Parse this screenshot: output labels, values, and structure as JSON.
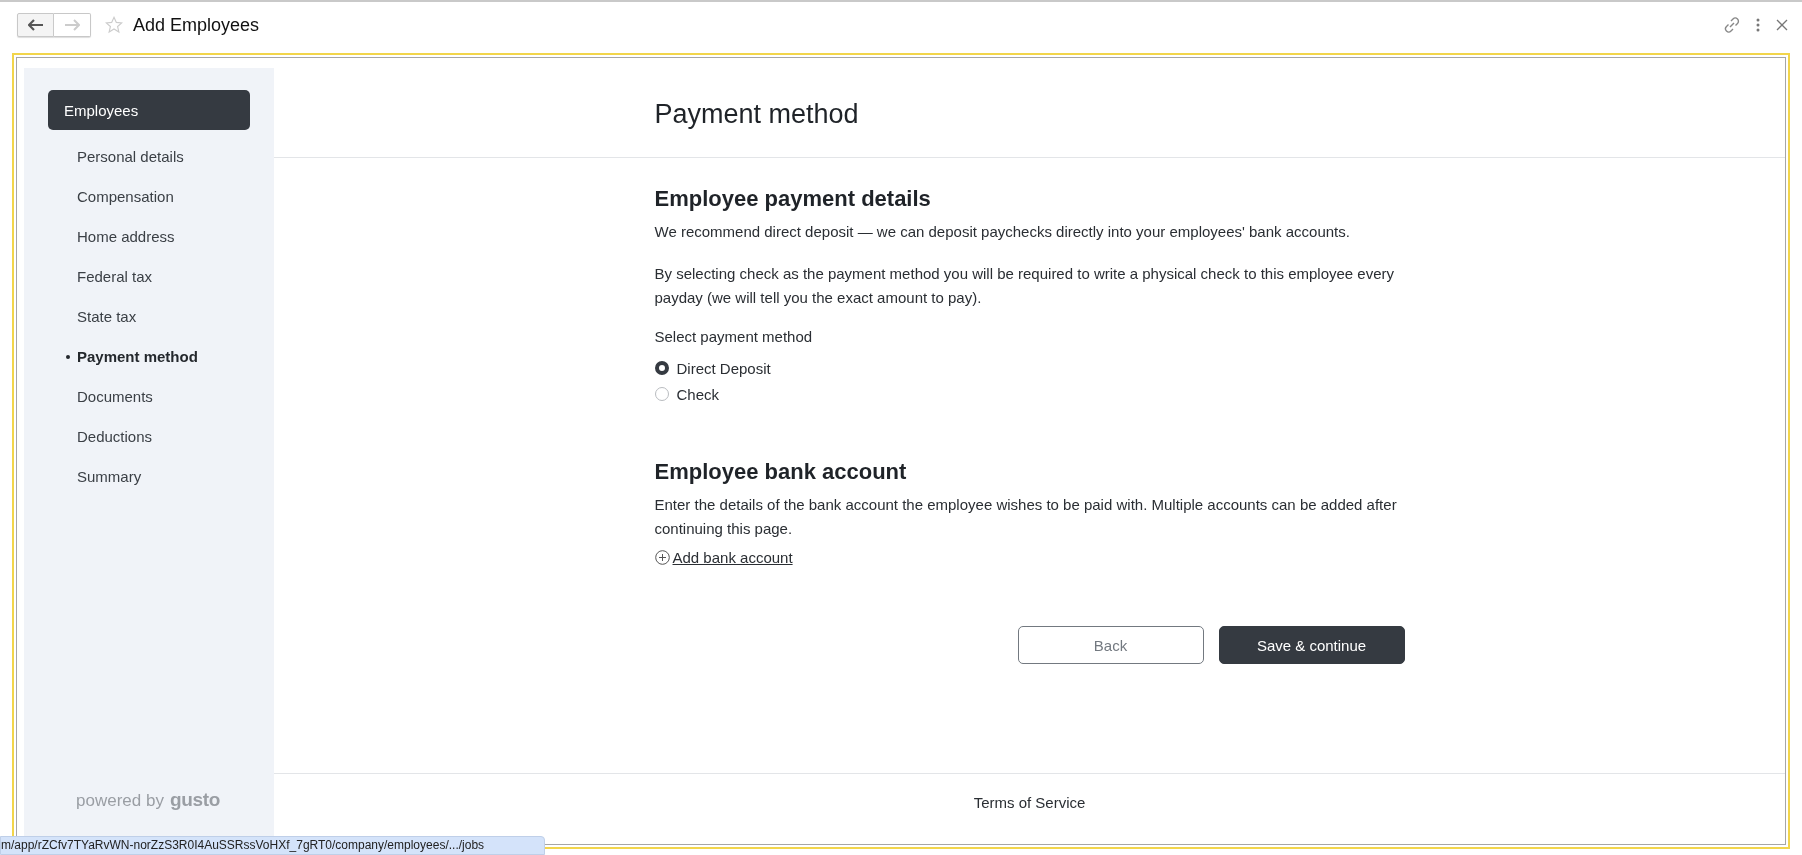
{
  "window": {
    "title": "Add Employees"
  },
  "sidebar": {
    "section": {
      "label": "Employees",
      "selected": true
    },
    "steps": [
      {
        "label": "Personal details",
        "selected": false
      },
      {
        "label": "Compensation",
        "selected": false
      },
      {
        "label": "Home address",
        "selected": false
      },
      {
        "label": "Federal tax",
        "selected": false
      },
      {
        "label": "State tax",
        "selected": false
      },
      {
        "label": "Payment method",
        "selected": true
      },
      {
        "label": "Documents",
        "selected": false
      },
      {
        "label": "Deductions",
        "selected": false
      },
      {
        "label": "Summary",
        "selected": false
      }
    ],
    "powered_by": {
      "text": "powered by",
      "brand": "gusto"
    }
  },
  "page_title": "Payment method",
  "payment_details": {
    "heading": "Employee payment details",
    "paragraphs": [
      "We recommend direct deposit — we can deposit paychecks directly into your employees' bank accounts.",
      "By selecting check as the payment method you will be required to write a physical check to this employee every payday (we will tell you the exact amount to pay)."
    ],
    "options_label": "Select payment method",
    "options": [
      {
        "label": "Direct Deposit",
        "selected": true
      },
      {
        "label": "Check",
        "selected": false
      }
    ]
  },
  "bank_account": {
    "heading": "Employee bank account",
    "text": "Enter the details of the bank account the employee wishes to be paid with. Multiple accounts can be added after continuing this page.",
    "link": "Add bank account"
  },
  "buttons": [
    {
      "label": "Back",
      "kind": "secondary"
    },
    {
      "label": "Save & continue",
      "kind": "primary"
    }
  ],
  "footer": {
    "link": "Terms of Service"
  },
  "status_url": "m/app/rZCfv7TYaRvWN-norZzS3R0I4AuSSRssVoHXf_7gRT0/company/employees/.../jobs"
}
